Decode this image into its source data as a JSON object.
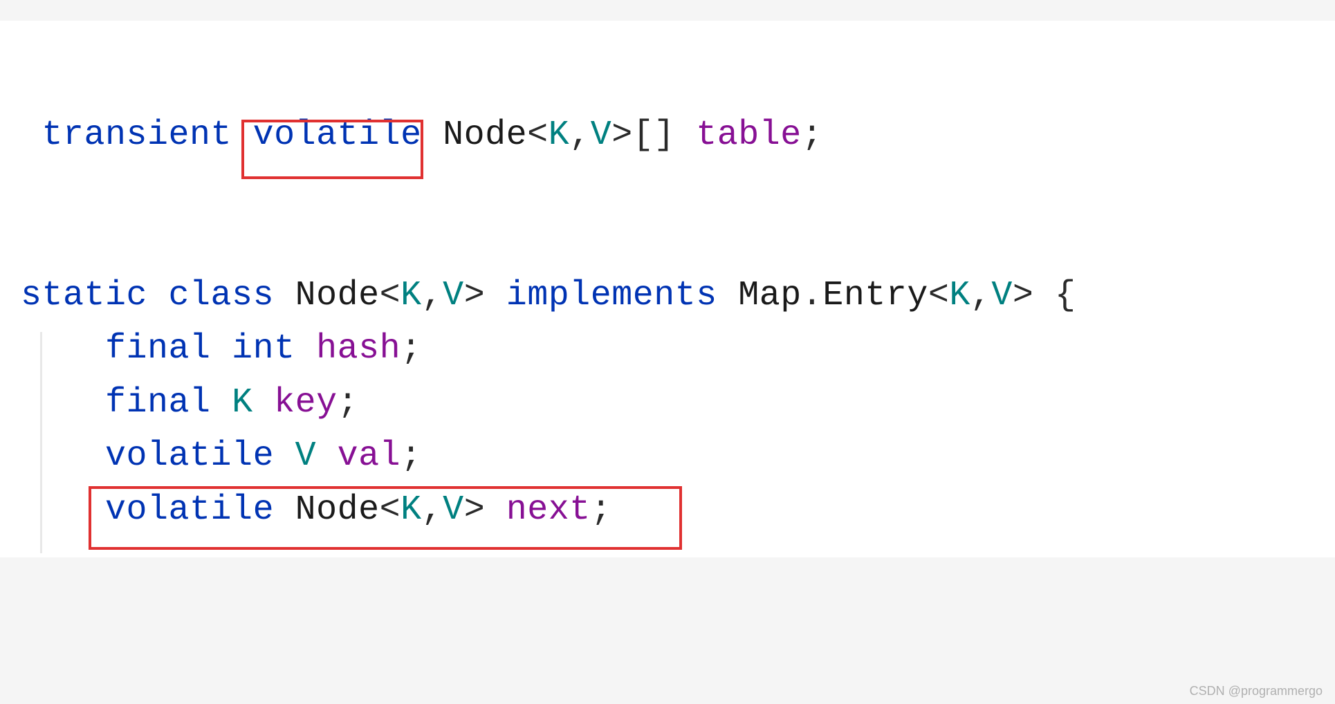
{
  "code": {
    "line1": {
      "kw_transient": "transient",
      "kw_volatile": "volatile",
      "type_node": "Node",
      "generic_open": "<",
      "type_k": "K",
      "comma1": ",",
      "type_v": "V",
      "generic_close": ">",
      "brackets": "[]",
      "var_table": "table",
      "semi": ";"
    },
    "line2": {
      "kw_static": "static",
      "kw_class": "class",
      "type_node": "Node",
      "generic_open": "<",
      "type_k": "K",
      "comma1": ",",
      "type_v": "V",
      "generic_close": ">",
      "kw_implements": "implements",
      "type_map": "Map",
      "dot": ".",
      "type_entry": "Entry",
      "generic_open2": "<",
      "type_k2": "K",
      "comma2": ",",
      "type_v2": "V",
      "generic_close2": ">",
      "brace_open": "{"
    },
    "line3": {
      "indent": "    ",
      "kw_final": "final",
      "kw_int": "int",
      "var_hash": "hash",
      "semi": ";"
    },
    "line4": {
      "indent": "    ",
      "kw_final": "final",
      "type_k": "K",
      "var_key": "key",
      "semi": ";"
    },
    "line5": {
      "indent": "    ",
      "kw_volatile": "volatile",
      "type_v": "V",
      "var_val": "val",
      "semi": ";"
    },
    "line6": {
      "indent": "    ",
      "kw_volatile": "volatile",
      "type_node": "Node",
      "generic_open": "<",
      "type_k": "K",
      "comma1": ",",
      "type_v": "V",
      "generic_close": ">",
      "var_next": "next",
      "semi": ";"
    }
  },
  "watermark": "CSDN @programmergo"
}
